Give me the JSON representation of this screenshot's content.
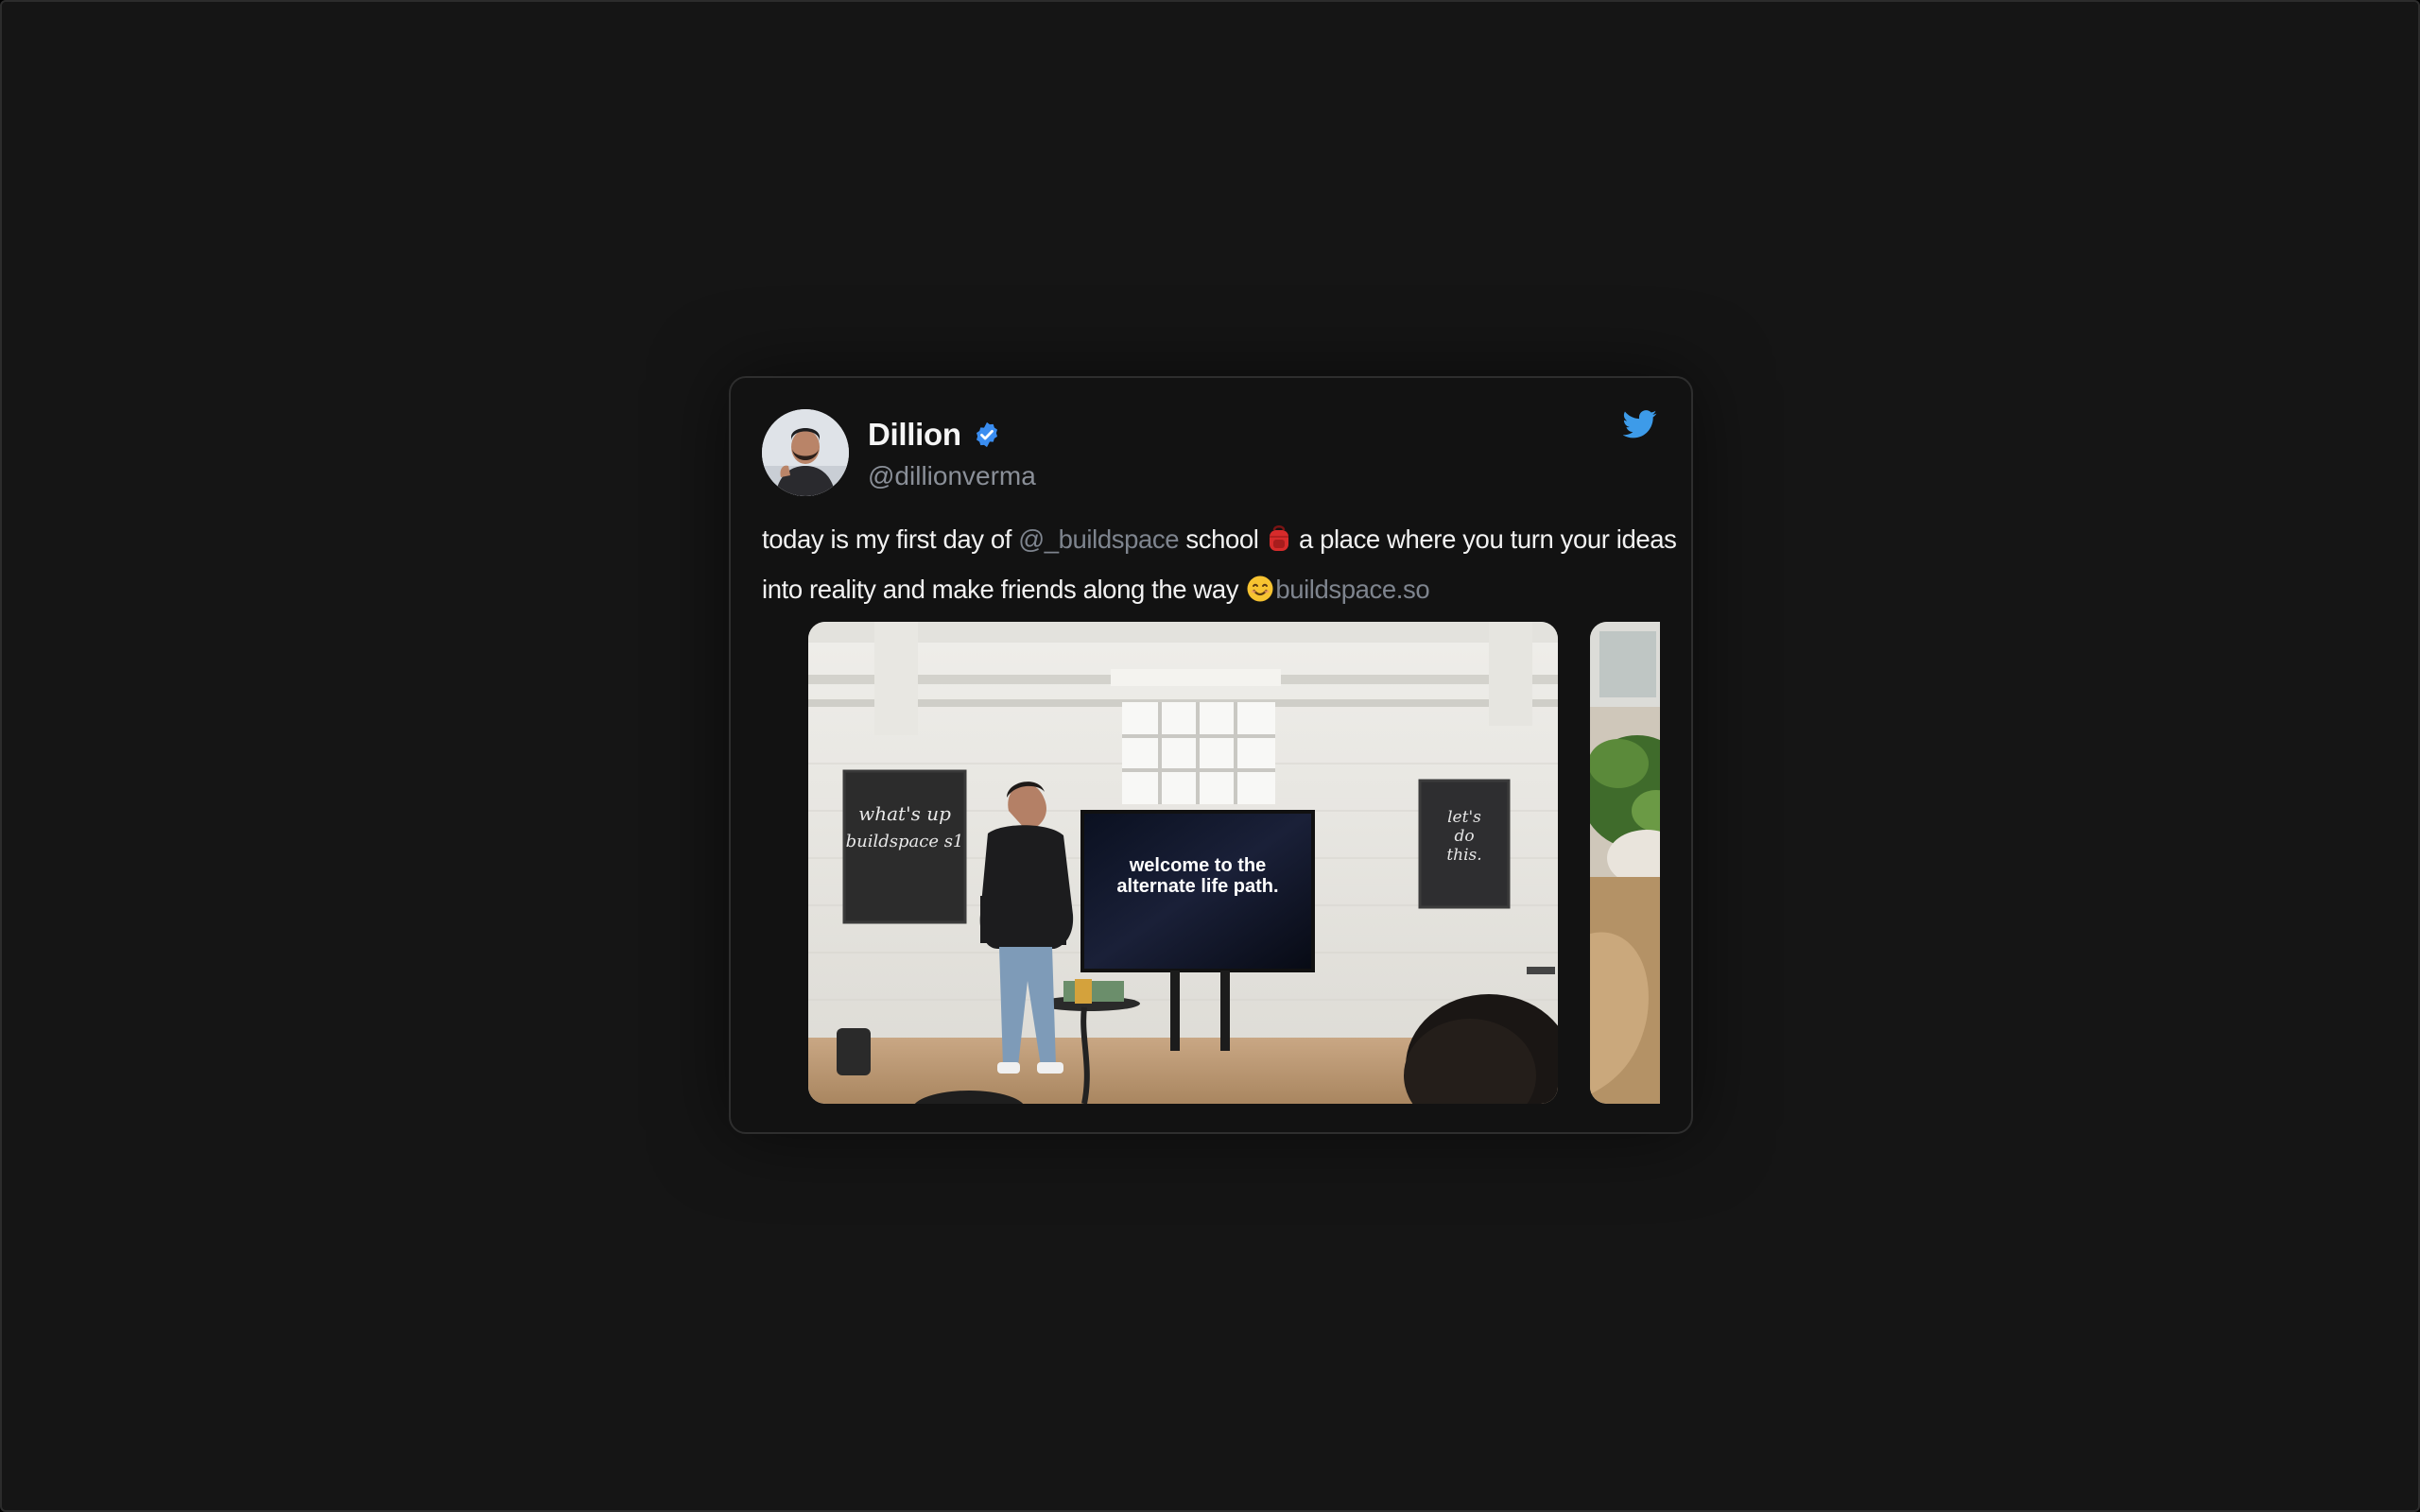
{
  "tweet": {
    "author_name": "Dillion",
    "author_handle": "@dillionverma",
    "verified": true,
    "text_parts": {
      "t1": "today is my first day of ",
      "mention": "@_buildspace",
      "t2": " school ",
      "t3": " a place where you turn your ideas",
      "t4": "into reality and make friends along the way ",
      "link": "buildspace.so"
    },
    "media": [
      {
        "chalkboard_left": [
          "what's up",
          "buildspace s1"
        ],
        "screen_text": [
          "welcome to the",
          "alternate life path."
        ],
        "chalkboard_right": [
          "let's",
          "do",
          "this."
        ]
      },
      {}
    ]
  },
  "icons": {
    "verified": "verified-badge-icon",
    "brand": "twitter-bird-icon",
    "emoji_1": "backpack-emoji",
    "emoji_2": "smiling-face-emoji"
  },
  "colors": {
    "background": "#151515",
    "card": "#121212",
    "verified_blue": "#3a8df0",
    "twitter_blue": "#3d9be9",
    "muted_text": "#7e848e"
  }
}
